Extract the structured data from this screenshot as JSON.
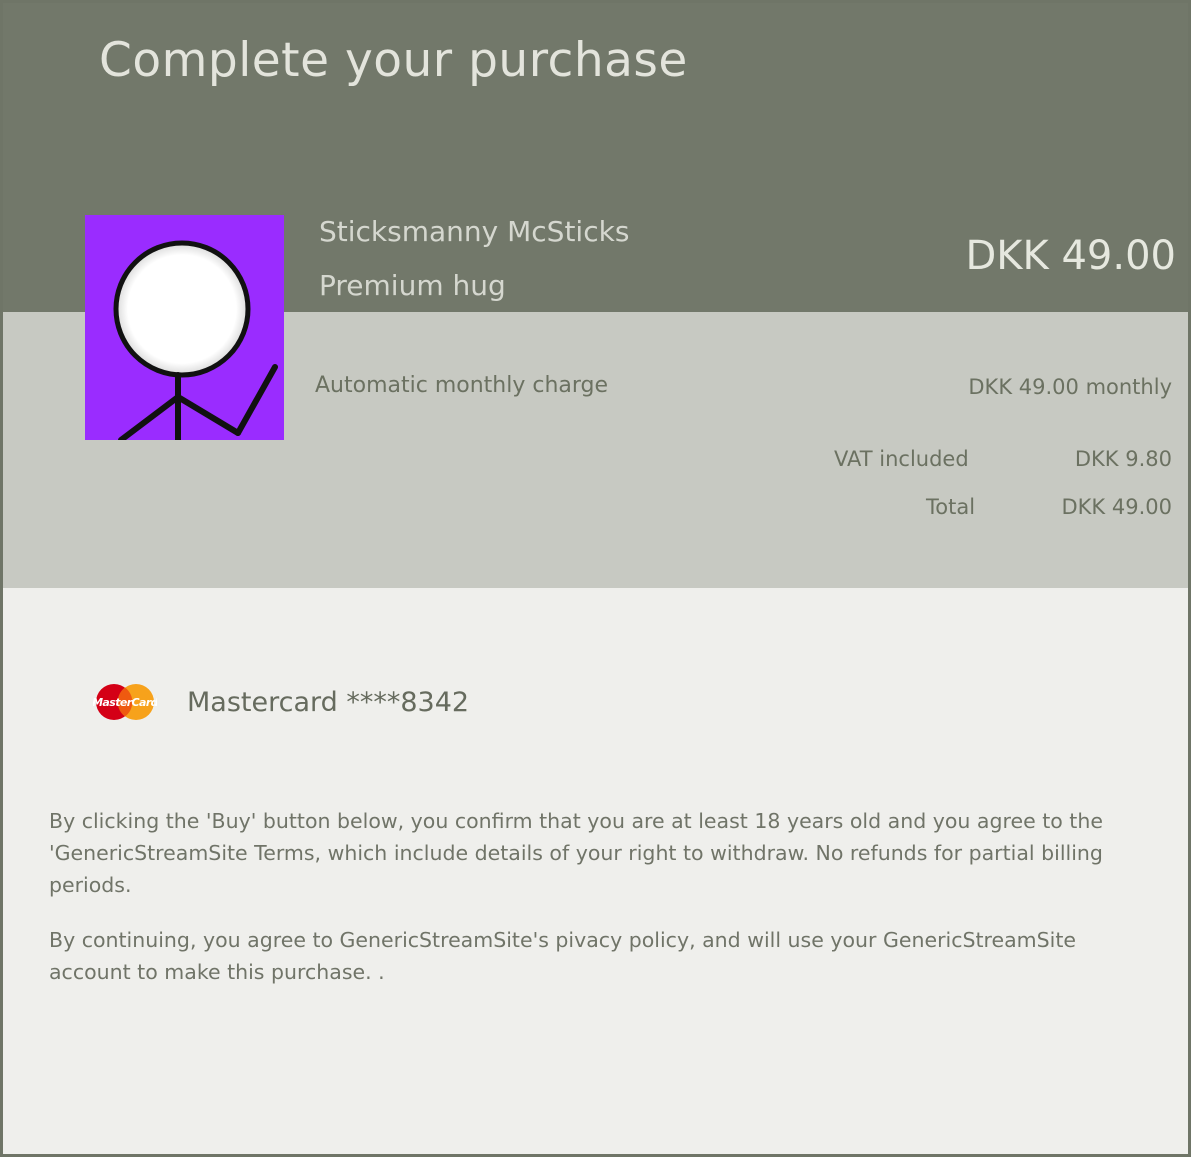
{
  "header": {
    "title": "Complete your purchase"
  },
  "product": {
    "creator": "Sticksmanny McSticks",
    "name": "Premium hug",
    "price": "DKK 49.00"
  },
  "summary": {
    "charge_label": "Automatic monthly charge",
    "charge_value": "DKK 49.00 monthly",
    "vat_label": "VAT included",
    "vat_value": "DKK 9.80",
    "total_label": "Total",
    "total_value": "DKK 49.00"
  },
  "payment": {
    "logo_text": "MasterCard",
    "card_label": "Mastercard ****8342"
  },
  "legal": {
    "paragraph_1": "By clicking  the 'Buy' button below, you confirm that you are at least 18 years old and you agree to the 'GenericStreamSite Terms, which include details of your right to withdraw. No refunds for partial billing periods.",
    "paragraph_2": "By continuing, you agree to GenericStreamSite's pivacy policy, and will use your GenericStreamSite account to make this purchase. ."
  },
  "colors": {
    "header_bg": "#72786a",
    "summary_bg": "#c7c9c2",
    "body_bg": "#efefec",
    "thumbnail_bg": "#9a2cff",
    "mastercard_red": "#d40016",
    "mastercard_orange": "#f7a21b"
  },
  "icons": {
    "thumbnail": "stick-figure-avatar",
    "payment": "mastercard-logo"
  }
}
